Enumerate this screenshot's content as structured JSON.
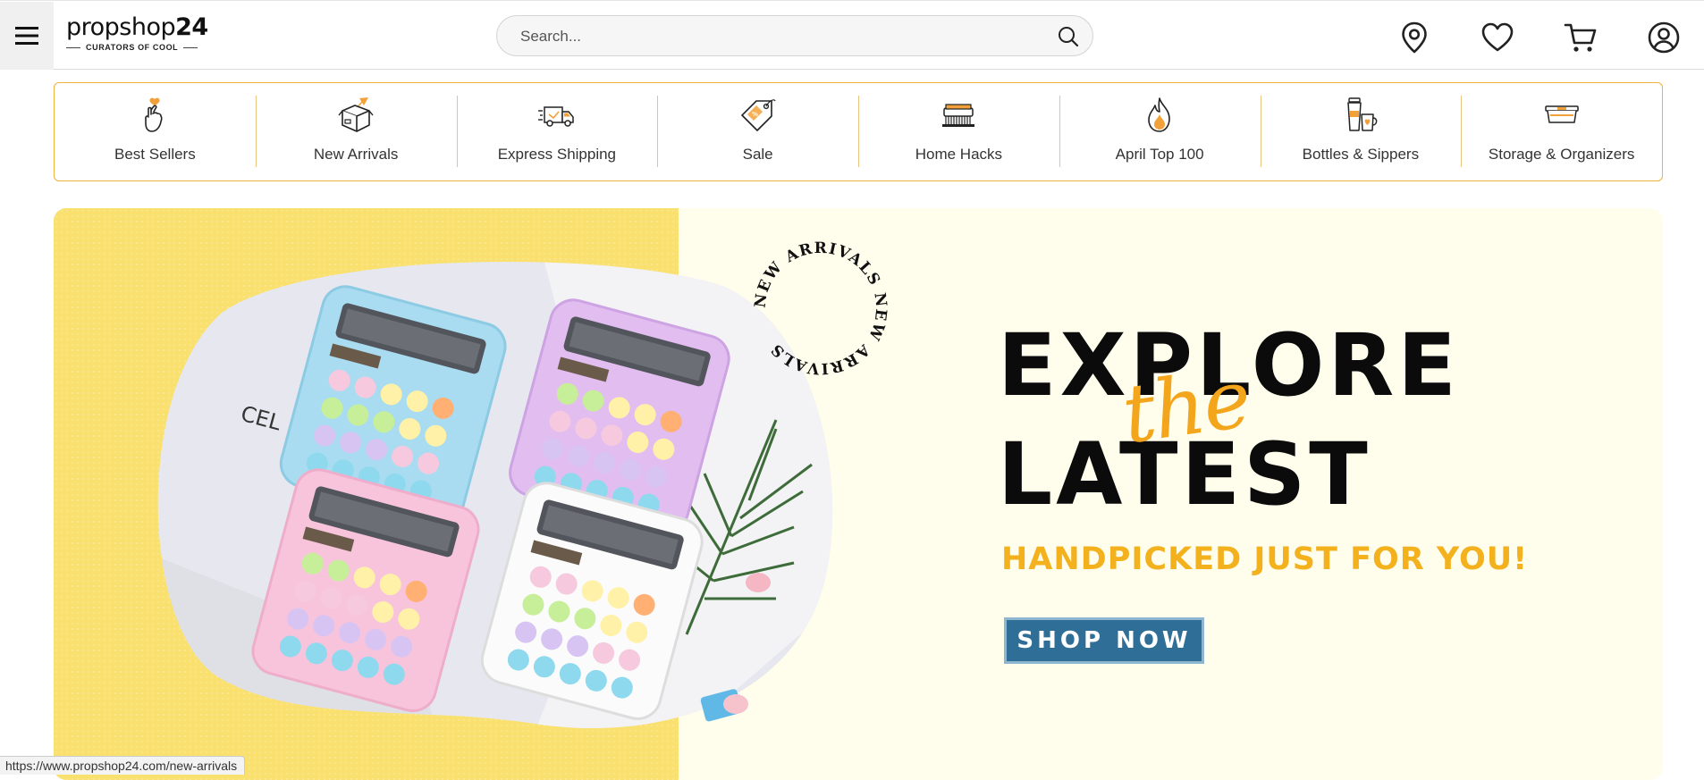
{
  "header": {
    "logo_brand": "propshop",
    "logo_number": "24",
    "logo_tagline": "CURATORS OF COOL",
    "search_placeholder": "Search...",
    "icons": [
      "menu-icon",
      "search-icon",
      "location-pin-icon",
      "heart-icon",
      "cart-icon",
      "user-icon"
    ]
  },
  "categories": [
    {
      "label": "Best Sellers",
      "icon": "finger-heart-icon"
    },
    {
      "label": "New Arrivals",
      "icon": "box-icon"
    },
    {
      "label": "Express Shipping",
      "icon": "delivery-truck-icon"
    },
    {
      "label": "Sale",
      "icon": "price-tag-icon"
    },
    {
      "label": "Home Hacks",
      "icon": "brush-icon"
    },
    {
      "label": "April Top 100",
      "icon": "flame-icon"
    },
    {
      "label": "Bottles & Sippers",
      "icon": "cups-icon"
    },
    {
      "label": "Storage & Organizers",
      "icon": "container-icon"
    }
  ],
  "banner": {
    "headline_1": "EXPLORE",
    "headline_script": "the",
    "headline_2": "LATEST",
    "subheadline": "HANDPICKED JUST FOR YOU!",
    "cta": "SHOP NOW",
    "stamp_text": "NEW ARRIVALS NEW ARRIVALS",
    "colors": {
      "left_bg": "#f9e06f",
      "right_bg": "#fffdec",
      "accent": "#f4b11e",
      "cta_bg": "#2f6e96"
    }
  },
  "status_bar": {
    "url": "https://www.propshop24.com/new-arrivals"
  },
  "colors": {
    "category_border": "#f0b13c"
  }
}
